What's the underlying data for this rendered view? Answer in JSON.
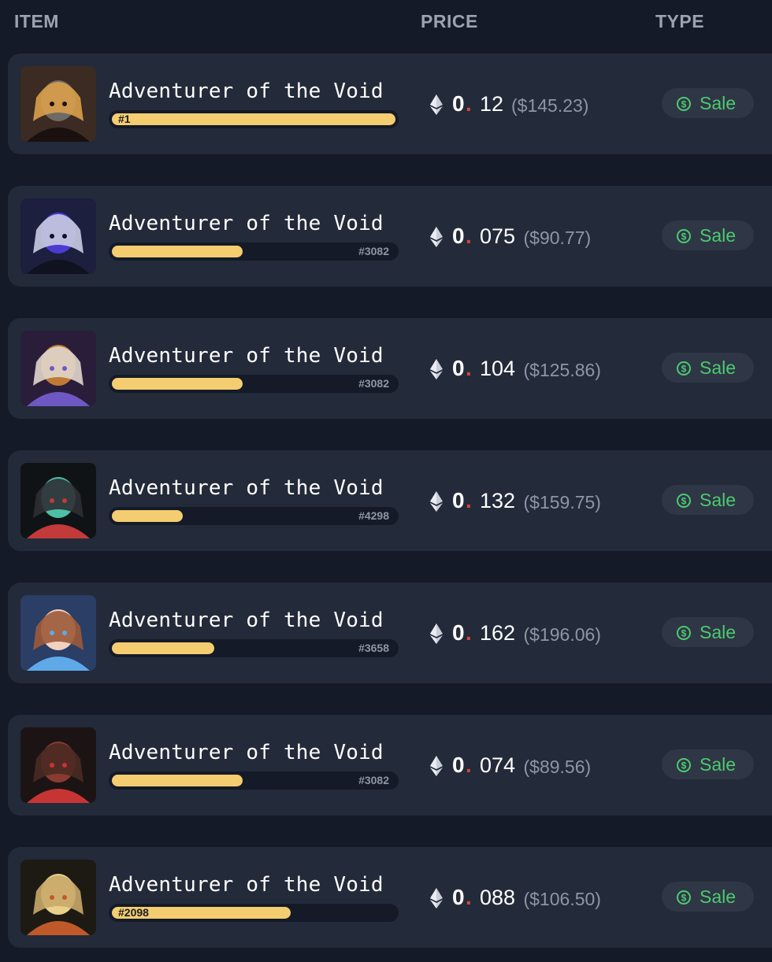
{
  "columns": {
    "item": "ITEM",
    "price": "PRICE",
    "type": "TYPE"
  },
  "currency_icon": "ethereum-icon",
  "sale_icon": "dollar-circle-icon",
  "accent_colors": {
    "rank_bar": "#f4cd71",
    "sale_text": "#4ccb6e",
    "decimal_dot": "#d4463a"
  },
  "rows": [
    {
      "name": "Adventurer of the Void",
      "rank": "#1",
      "rank_fill": 1.0,
      "price_int": "0",
      "price_frac": "12",
      "price_usd": "($145.23)",
      "type": "Sale"
    },
    {
      "name": "Adventurer of the Void",
      "rank": "#3082",
      "rank_fill": 0.46,
      "price_int": "0",
      "price_frac": "075",
      "price_usd": "($90.77)",
      "type": "Sale"
    },
    {
      "name": "Adventurer of the Void",
      "rank": "#3082",
      "rank_fill": 0.46,
      "price_int": "0",
      "price_frac": "104",
      "price_usd": "($125.86)",
      "type": "Sale"
    },
    {
      "name": "Adventurer of the Void",
      "rank": "#4298",
      "rank_fill": 0.25,
      "price_int": "0",
      "price_frac": "132",
      "price_usd": "($159.75)",
      "type": "Sale"
    },
    {
      "name": "Adventurer of the Void",
      "rank": "#3658",
      "rank_fill": 0.36,
      "price_int": "0",
      "price_frac": "162",
      "price_usd": "($196.06)",
      "type": "Sale"
    },
    {
      "name": "Adventurer of the Void",
      "rank": "#3082",
      "rank_fill": 0.46,
      "price_int": "0",
      "price_frac": "074",
      "price_usd": "($89.56)",
      "type": "Sale"
    },
    {
      "name": "Adventurer of the Void",
      "rank": "#2098",
      "rank_fill": 0.63,
      "price_int": "0",
      "price_frac": "088",
      "price_usd": "($106.50)",
      "type": "Sale"
    }
  ]
}
